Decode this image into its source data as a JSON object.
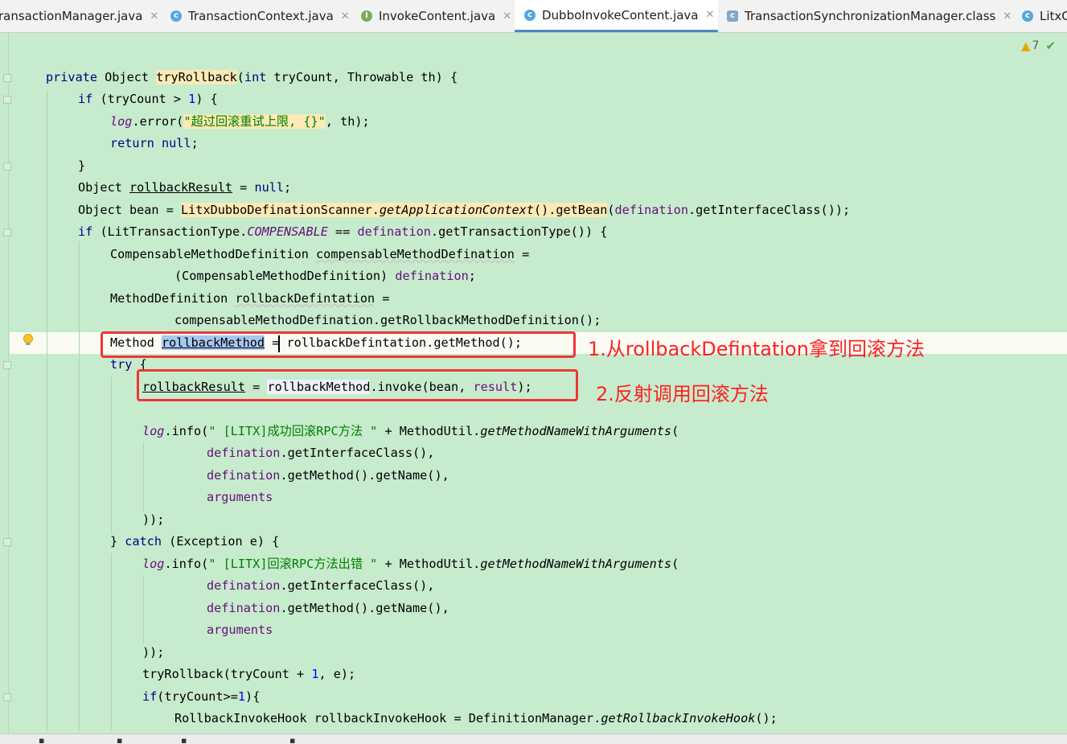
{
  "tabs": [
    {
      "label": "ransactionManager.java",
      "icon": "java-class-icon"
    },
    {
      "label": "TransactionContext.java",
      "icon": "java-class-icon"
    },
    {
      "label": "InvokeContent.java",
      "icon": "java-interface-icon"
    },
    {
      "label": "DubboInvokeContent.java",
      "icon": "java-class-icon",
      "active": true
    },
    {
      "label": "TransactionSynchronizationManager.class",
      "icon": "compiled-class-icon"
    },
    {
      "label": "LitxC",
      "icon": "java-class-icon"
    }
  ],
  "inspections": {
    "warning_count": "7"
  },
  "code": {
    "l1": {
      "a": "private ",
      "b": "Object ",
      "c": "tryRollback",
      "d": "(",
      "e": "int ",
      "f": "tryCount, Throwable th) {"
    },
    "l2": {
      "a": "if ",
      "b": "(tryCount > ",
      "c": "1",
      "d": ") {"
    },
    "l3": {
      "a": "log",
      "b": ".error(",
      "c": "\"超过回滚重试上限, {}\"",
      "d": ", th);"
    },
    "l4": {
      "a": "return ",
      "b": "null",
      "c": ";"
    },
    "l5": {
      "a": "}"
    },
    "l6": {
      "a": "Object ",
      "b": "rollbackResult",
      "c": " = ",
      "d": "null",
      "e": ";"
    },
    "l7": {
      "a": "Object bean = ",
      "b": "LitxDubboDefinationScanner.",
      "c": "getApplicationContext",
      "d": "().getBean",
      "e": "(",
      "f": "defination",
      "g": ".getInterfaceClass());"
    },
    "l8": {
      "a": "if ",
      "b": "(LitTransactionType.",
      "c": "COMPENSABLE",
      "d": " == ",
      "e": "defination",
      "f": ".getTransactionType()) {"
    },
    "l9": {
      "a": "CompensableMethodDefinition ",
      "b": "compensableMethodDefination",
      "c": " ="
    },
    "l10": {
      "a": "(CompensableMethodDefinition) ",
      "b": "defination",
      "c": ";"
    },
    "l11": {
      "a": "MethodDefinition ",
      "b": "rollbackDefintation",
      "c": " ="
    },
    "l12": {
      "a": "compensableMethodDefination.getRollbackMethodDefinition();"
    },
    "l13": {
      "a": "Method ",
      "b": "rollbackMethod",
      "c": " = rollbackDefintation.getMethod();"
    },
    "l14": {
      "a": "try ",
      "b": "{"
    },
    "l15": {
      "a": "rollbackResult",
      "b": " = ",
      "c": "rollbackMethod",
      "d": ".invoke(bean, ",
      "e": "result",
      "f": ");"
    },
    "l16": {
      "a": "log",
      "b": ".info(",
      "c": "\" [LITX]成功回滚RPC方法 \"",
      "d": " + MethodUtil.",
      "e": "getMethodNameWithArguments",
      "f": "("
    },
    "l17": {
      "a": "defination",
      "b": ".getInterfaceClass(),"
    },
    "l18": {
      "a": "defination",
      "b": ".getMethod().getName(),"
    },
    "l19": {
      "a": "arguments"
    },
    "l20": {
      "a": "));"
    },
    "l21": {
      "a": "} ",
      "b": "catch ",
      "c": "(Exception e) {"
    },
    "l22": {
      "a": "log",
      "b": ".info(",
      "c": "\" [LITX]回滚RPC方法出错 \"",
      "d": " + MethodUtil.",
      "e": "getMethodNameWithArguments",
      "f": "("
    },
    "l23": {
      "a": "defination",
      "b": ".getInterfaceClass(),"
    },
    "l24": {
      "a": "defination",
      "b": ".getMethod().getName(),"
    },
    "l25": {
      "a": "arguments"
    },
    "l26": {
      "a": "));"
    },
    "l27": {
      "a": "tryRollback(tryCount + ",
      "b": "1",
      "c": ", e);"
    },
    "l28": {
      "a": "if",
      "b": "(tryCount>=",
      "c": "1",
      "d": "){"
    },
    "l29": {
      "a": "RollbackInvokeHook rollbackInvokeHook = DefinitionManager.",
      "b": "getRollbackInvokeHook",
      "c": "();"
    }
  },
  "annotations": {
    "note1": "1.从rollbackDefintation拿到回滚方法",
    "note2": "2.反射调用回滚方法"
  },
  "colors": {
    "editor_bg": "#c7ebcd",
    "highlight_box": "#f03535",
    "annotation_text": "#ff2121"
  }
}
